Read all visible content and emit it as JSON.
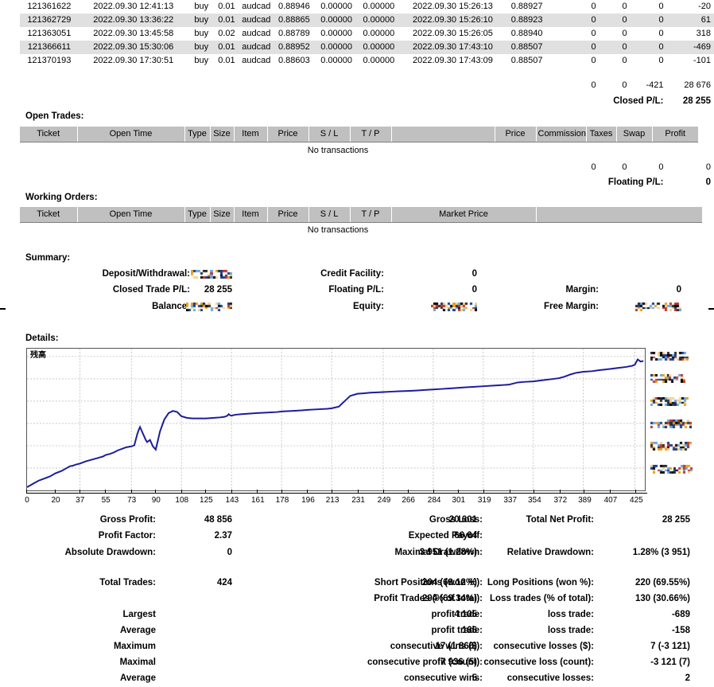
{
  "closed_trades": {
    "rows": [
      {
        "ticket": "121361622",
        "open_time": "2022.09.30 12:41:13",
        "type": "buy",
        "size": "0.01",
        "item": "audcad",
        "price": "0.88946",
        "sl": "0.00000",
        "tp": "0.00000",
        "close_time": "2022.09.30 15:26:13",
        "close_price": "0.88927",
        "commission": "0",
        "taxes": "0",
        "swap": "0",
        "profit": "-20"
      },
      {
        "ticket": "121362729",
        "open_time": "2022.09.30 13:36:22",
        "type": "buy",
        "size": "0.01",
        "item": "audcad",
        "price": "0.88865",
        "sl": "0.00000",
        "tp": "0.00000",
        "close_time": "2022.09.30 15:26:10",
        "close_price": "0.88923",
        "commission": "0",
        "taxes": "0",
        "swap": "0",
        "profit": "61"
      },
      {
        "ticket": "121363051",
        "open_time": "2022.09.30 13:45:58",
        "type": "buy",
        "size": "0.02",
        "item": "audcad",
        "price": "0.88789",
        "sl": "0.00000",
        "tp": "0.00000",
        "close_time": "2022.09.30 15:26:05",
        "close_price": "0.88940",
        "commission": "0",
        "taxes": "0",
        "swap": "0",
        "profit": "318"
      },
      {
        "ticket": "121366611",
        "open_time": "2022.09.30 15:30:06",
        "type": "buy",
        "size": "0.01",
        "item": "audcad",
        "price": "0.88952",
        "sl": "0.00000",
        "tp": "0.00000",
        "close_time": "2022.09.30 17:43:10",
        "close_price": "0.88507",
        "commission": "0",
        "taxes": "0",
        "swap": "0",
        "profit": "-469"
      },
      {
        "ticket": "121370193",
        "open_time": "2022.09.30 17:30:51",
        "type": "buy",
        "size": "0.01",
        "item": "audcad",
        "price": "0.88603",
        "sl": "0.00000",
        "tp": "0.00000",
        "close_time": "2022.09.30 17:43:09",
        "close_price": "0.88507",
        "commission": "0",
        "taxes": "0",
        "swap": "0",
        "profit": "-101"
      }
    ],
    "totals": {
      "commission": "0",
      "taxes": "0",
      "swap": "-421",
      "profit": "28 676"
    },
    "closed_pl_label": "Closed P/L:",
    "closed_pl_value": "28 255"
  },
  "open_trades": {
    "heading": "Open Trades:",
    "columns": [
      "Ticket",
      "Open Time",
      "Type",
      "Size",
      "Item",
      "Price",
      "S / L",
      "T / P",
      "",
      "Price",
      "Commission",
      "Taxes",
      "Swap",
      "Profit"
    ],
    "empty_text": "No transactions",
    "totals": {
      "commission": "0",
      "taxes": "0",
      "swap": "0",
      "profit": "0"
    },
    "floating_pl_label": "Floating P/L:",
    "floating_pl_value": "0"
  },
  "working_orders": {
    "heading": "Working Orders:",
    "columns": [
      "Ticket",
      "Open Time",
      "Type",
      "Size",
      "Item",
      "Price",
      "S / L",
      "T / P",
      "Market Price",
      ""
    ],
    "empty_text": "No transactions"
  },
  "summary": {
    "heading": "Summary:",
    "rows": [
      {
        "label": "Deposit/Withdrawal:",
        "value": "",
        "redacted": true,
        "label2": "Credit Facility:",
        "value2": "0",
        "redacted2": false,
        "label3": "",
        "value3": "",
        "redacted3": false
      },
      {
        "label": "Closed Trade P/L:",
        "value": "28 255",
        "redacted": false,
        "label2": "Floating P/L:",
        "value2": "0",
        "redacted2": false,
        "label3": "Margin:",
        "value3": "0",
        "redacted3": false
      },
      {
        "label": "Balance:",
        "value": "",
        "redacted": true,
        "label2": "Equity:",
        "value2": "",
        "redacted2": true,
        "label3": "Free Margin:",
        "value3": "",
        "redacted3": true
      }
    ]
  },
  "details": {
    "heading": "Details:"
  },
  "chart_data": {
    "type": "line",
    "title": "",
    "series_label": "残高",
    "xlabel": "",
    "ylabel": "",
    "grid": true,
    "legend": "none",
    "line_color": "#1c1c9e",
    "x_ticks": [
      0,
      20,
      37,
      55,
      73,
      90,
      108,
      125,
      143,
      161,
      178,
      196,
      213,
      231,
      249,
      266,
      284,
      301,
      319,
      337,
      354,
      372,
      389,
      407,
      425
    ],
    "y_tick_labels_redacted": true,
    "y_tick_count": 6,
    "xlim": [
      0,
      432
    ],
    "x": [
      0,
      4,
      8,
      12,
      16,
      20,
      24,
      28,
      30,
      32,
      34,
      37,
      41,
      45,
      49,
      53,
      55,
      58,
      61,
      63,
      65,
      67,
      69,
      71,
      73,
      75,
      76,
      77,
      78,
      79,
      80,
      81,
      82,
      83,
      84,
      85,
      86,
      87,
      88,
      90,
      93,
      96,
      99,
      102,
      105,
      108,
      112,
      116,
      120,
      125,
      130,
      135,
      138,
      140,
      141,
      142,
      143,
      144,
      146,
      150,
      155,
      161,
      168,
      175,
      178,
      185,
      192,
      196,
      203,
      210,
      213,
      218,
      222,
      226,
      231,
      236,
      240,
      245,
      249,
      255,
      260,
      266,
      272,
      278,
      284,
      290,
      296,
      301,
      307,
      313,
      319,
      325,
      331,
      337,
      340,
      343,
      347,
      354,
      360,
      366,
      372,
      376,
      380,
      384,
      389,
      395,
      400,
      407,
      413,
      419,
      423,
      425,
      427,
      429,
      431
    ],
    "y": [
      3.0,
      6.0,
      9.0,
      11.0,
      13.0,
      16.0,
      18.0,
      21.0,
      22.5,
      23.0,
      24.0,
      25.0,
      27.0,
      28.5,
      30.0,
      31.5,
      33.0,
      34.0,
      35.5,
      37.0,
      38.0,
      39.0,
      40.0,
      40.5,
      41.0,
      42.0,
      47.0,
      52.0,
      56.0,
      59.0,
      56.0,
      53.0,
      50.0,
      47.0,
      45.0,
      46.0,
      47.0,
      44.0,
      41.0,
      38.0,
      55.0,
      66.0,
      72.0,
      74.0,
      73.0,
      69.0,
      67.5,
      67.0,
      67.0,
      67.0,
      67.5,
      68.0,
      68.5,
      69.5,
      71.0,
      70.0,
      69.5,
      70.0,
      70.5,
      71.0,
      71.5,
      72.0,
      72.5,
      73.0,
      73.5,
      74.0,
      74.5,
      75.0,
      75.5,
      76.0,
      76.5,
      78.0,
      83.0,
      88.0,
      90.0,
      90.5,
      91.0,
      91.3,
      91.6,
      92.0,
      92.3,
      92.6,
      93.0,
      93.5,
      94.0,
      94.5,
      95.0,
      95.5,
      96.0,
      96.5,
      97.0,
      97.5,
      98.0,
      98.5,
      99.5,
      100.5,
      101.0,
      101.5,
      102.5,
      103.5,
      104.5,
      106.0,
      108.0,
      109.5,
      110.5,
      111.0,
      112.0,
      113.0,
      114.0,
      115.0,
      116.0,
      117.0,
      122.0,
      120.0,
      120.5
    ],
    "ylim": [
      0,
      132
    ]
  },
  "stats": {
    "rows": [
      {
        "l1": "Gross Profit:",
        "v1": "48 856",
        "l2": "Gross Loss:",
        "v2": "20 601",
        "l3": "Total Net Profit:",
        "v3": "28 255"
      },
      {
        "l1": "Profit Factor:",
        "v1": "2.37",
        "l2": "Expected Payoff:",
        "v2": "66.64",
        "l3": "",
        "v3": ""
      },
      {
        "l1": "Absolute Drawdown:",
        "v1": "0",
        "l2": "Maximal Drawdown:",
        "v2": "3 951 (1.28%)",
        "l3": "Relative Drawdown:",
        "v3": "1.28% (3 951)"
      },
      {
        "l1": "Total Trades:",
        "v1": "424",
        "l2": "Short Positions (won %):",
        "v2": "204 (69.12%)",
        "l3": "Long Positions (won %):",
        "v3": "220 (69.55%)"
      },
      {
        "l1": "",
        "v1": "",
        "l2": "Profit Trades (% of total):",
        "v2": "294 (69.34%)",
        "l3": "Loss trades (% of total):",
        "v3": "130 (30.66%)"
      },
      {
        "l1": "Largest",
        "v1": "",
        "l2": "profit trade:",
        "v2": "4 105",
        "l3": "loss trade:",
        "v3": "-689"
      },
      {
        "l1": "Average",
        "v1": "",
        "l2": "profit trade:",
        "v2": "166",
        "l3": "loss trade:",
        "v3": "-158"
      },
      {
        "l1": "Maximum",
        "v1": "",
        "l2": "consecutive wins ($):",
        "v2": "17 (1 866)",
        "l3": "consecutive losses ($):",
        "v3": "7 (-3 121)"
      },
      {
        "l1": "Maximal",
        "v1": "",
        "l2": "consecutive profit (count):",
        "v2": "7 936 (5)",
        "l3": "consecutive loss (count):",
        "v3": "-3 121 (7)"
      },
      {
        "l1": "Average",
        "v1": "",
        "l2": "consecutive wins:",
        "v2": "5",
        "l3": "consecutive losses:",
        "v3": "2"
      }
    ]
  }
}
